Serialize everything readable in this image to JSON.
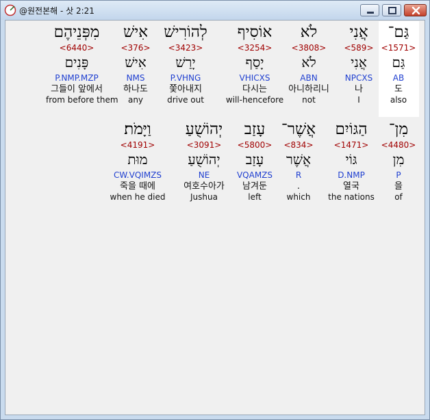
{
  "window": {
    "title": "@원전본해 - 삿 2:21",
    "buttons": {
      "minimize": "minimize",
      "maximize": "maximize",
      "close": "close"
    }
  },
  "icons": {
    "app": "compass-icon",
    "minimize": "minimize-icon",
    "maximize": "maximize-icon",
    "close": "close-icon"
  },
  "colors": {
    "strong_number": "#a00000",
    "parsing": "#1f3fd0",
    "highlight": "#ffffff"
  },
  "rows": [
    {
      "words": [
        {
          "hebrew": "גַּם־",
          "strong": "<1571>",
          "lemma": "גַּם",
          "parse": "AB",
          "korean": "도",
          "english": "also",
          "highlighted": true
        },
        {
          "hebrew": "אֲנִי",
          "strong": "<589>",
          "lemma": "אֲנִי",
          "parse": "NPCXS",
          "korean": "나",
          "english": "I"
        },
        {
          "hebrew": "לֹא",
          "strong": "<3808>",
          "lemma": "לֹא",
          "parse": "ABN",
          "korean": "아니하리니",
          "english": "not"
        },
        {
          "hebrew": "אוֹסִיף",
          "strong": "<3254>",
          "lemma": "יָסַף",
          "parse": "VHICXS",
          "korean": "다시는",
          "english": "will-hencefore"
        },
        {
          "hebrew": "לְהוֹרִישׁ",
          "strong": "<3423>",
          "lemma": "יָרַשׁ",
          "parse": "P.VHNG",
          "korean": "쫓아내지",
          "english": "drive out"
        },
        {
          "hebrew": "אִישׁ",
          "strong": "<376>",
          "lemma": "אִישׁ",
          "parse": "NMS",
          "korean": "하나도",
          "english": "any"
        },
        {
          "hebrew": "מִפְּנֵיהֶם",
          "strong": "<6440>",
          "lemma": "פָּנִים",
          "parse": "P.NMP.MZP",
          "korean": "그들이 앞에서",
          "english": "from before them"
        }
      ]
    },
    {
      "words": [
        {
          "hebrew": "מִן־",
          "strong": "<4480>",
          "lemma": "מִן",
          "parse": "P",
          "korean": "을",
          "english": "of"
        },
        {
          "hebrew": "הַגּוֹיִם",
          "strong": "<1471>",
          "lemma": "גּוֹי",
          "parse": "D.NMP",
          "korean": "열국",
          "english": "the nations"
        },
        {
          "hebrew": "אֲשֶׁר־",
          "strong": "<834>",
          "lemma": "אֲשֶׁר",
          "parse": "R",
          "korean": ".",
          "english": "which"
        },
        {
          "hebrew": "עָזַב",
          "strong": "<5800>",
          "lemma": "עָזַב",
          "parse": "VQAMZS",
          "korean": "남겨둔",
          "english": "left"
        },
        {
          "hebrew": "יְהוֹשֻׁעַ",
          "strong": "<3091>",
          "lemma": "יְהוֹשֻׁעַ",
          "parse": "NE",
          "korean": "여호수아가",
          "english": "Jushua"
        },
        {
          "hebrew": "וַיָּמֹת׃",
          "strong": "<4191>",
          "lemma": "מוּת",
          "parse": "CW.VQIMZS",
          "korean": "죽을 때에",
          "english": "when he died"
        }
      ]
    }
  ]
}
